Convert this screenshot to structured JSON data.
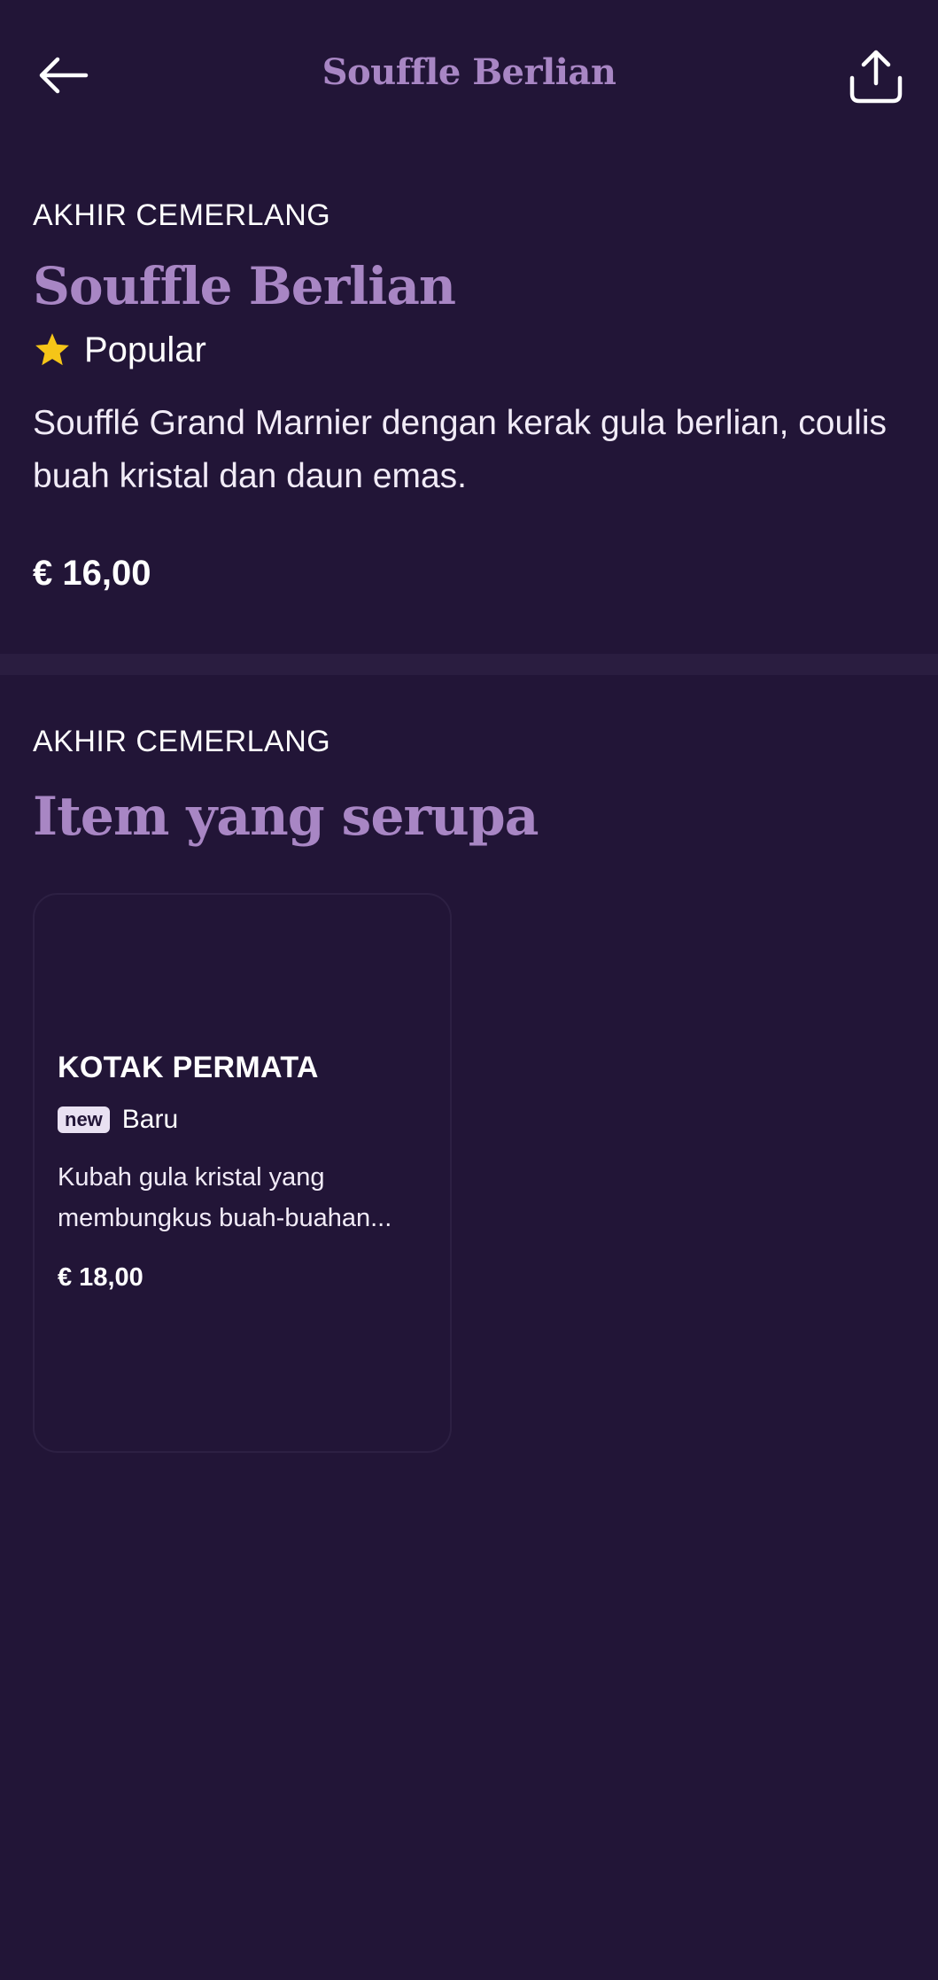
{
  "header": {
    "title": "Souffle Berlian",
    "back_icon": "arrow-left-icon",
    "share_icon": "share-icon"
  },
  "item": {
    "category": "AKHIR CEMERLANG",
    "name": "Souffle Berlian",
    "badge_icon": "star-icon",
    "badge_label": "Popular",
    "description": "Soufflé Grand Marnier dengan kerak gula berlian, coulis buah kristal dan daun emas.",
    "price": "€ 16,00"
  },
  "similar": {
    "category": "AKHIR CEMERLANG",
    "title": "Item yang serupa",
    "items": [
      {
        "name": "KOTAK PERMATA",
        "tag": "new",
        "badge_label": "Baru",
        "description": "Kubah gula kristal yang membungkus buah-buahan...",
        "price": "€ 18,00"
      }
    ]
  },
  "colors": {
    "background": "#221537",
    "accent": "#a886c4",
    "star": "#f5c518"
  }
}
